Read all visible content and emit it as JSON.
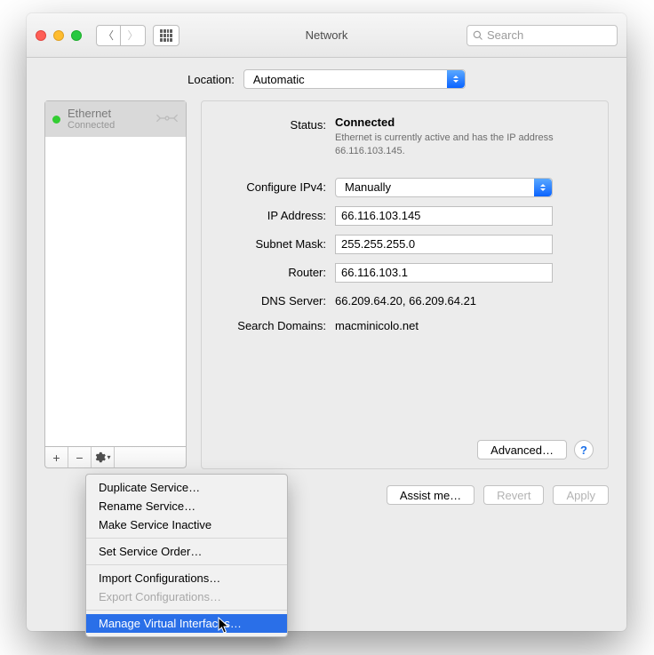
{
  "window": {
    "title": "Network",
    "search_placeholder": "Search"
  },
  "location": {
    "label": "Location:",
    "value": "Automatic"
  },
  "sidebar": {
    "services": [
      {
        "name": "Ethernet",
        "state": "Connected"
      }
    ],
    "plus": "+",
    "minus": "−"
  },
  "details": {
    "status_label": "Status:",
    "status_value": "Connected",
    "status_sub": "Ethernet is currently active and has the IP address 66.116.103.145.",
    "ipv4_label": "Configure IPv4:",
    "ipv4_value": "Manually",
    "ip_label": "IP Address:",
    "ip_value": "66.116.103.145",
    "mask_label": "Subnet Mask:",
    "mask_value": "255.255.255.0",
    "router_label": "Router:",
    "router_value": "66.116.103.1",
    "dns_label": "DNS Server:",
    "dns_value": "66.209.64.20, 66.209.64.21",
    "search_label": "Search Domains:",
    "search_value": "macminicolo.net",
    "advanced": "Advanced…",
    "help": "?"
  },
  "buttons": {
    "assist": "Assist me…",
    "revert": "Revert",
    "apply": "Apply"
  },
  "menu": {
    "duplicate": "Duplicate Service…",
    "rename": "Rename Service…",
    "inactive": "Make Service Inactive",
    "order": "Set Service Order…",
    "import": "Import Configurations…",
    "export": "Export Configurations…",
    "manage": "Manage Virtual Interfaces…"
  }
}
